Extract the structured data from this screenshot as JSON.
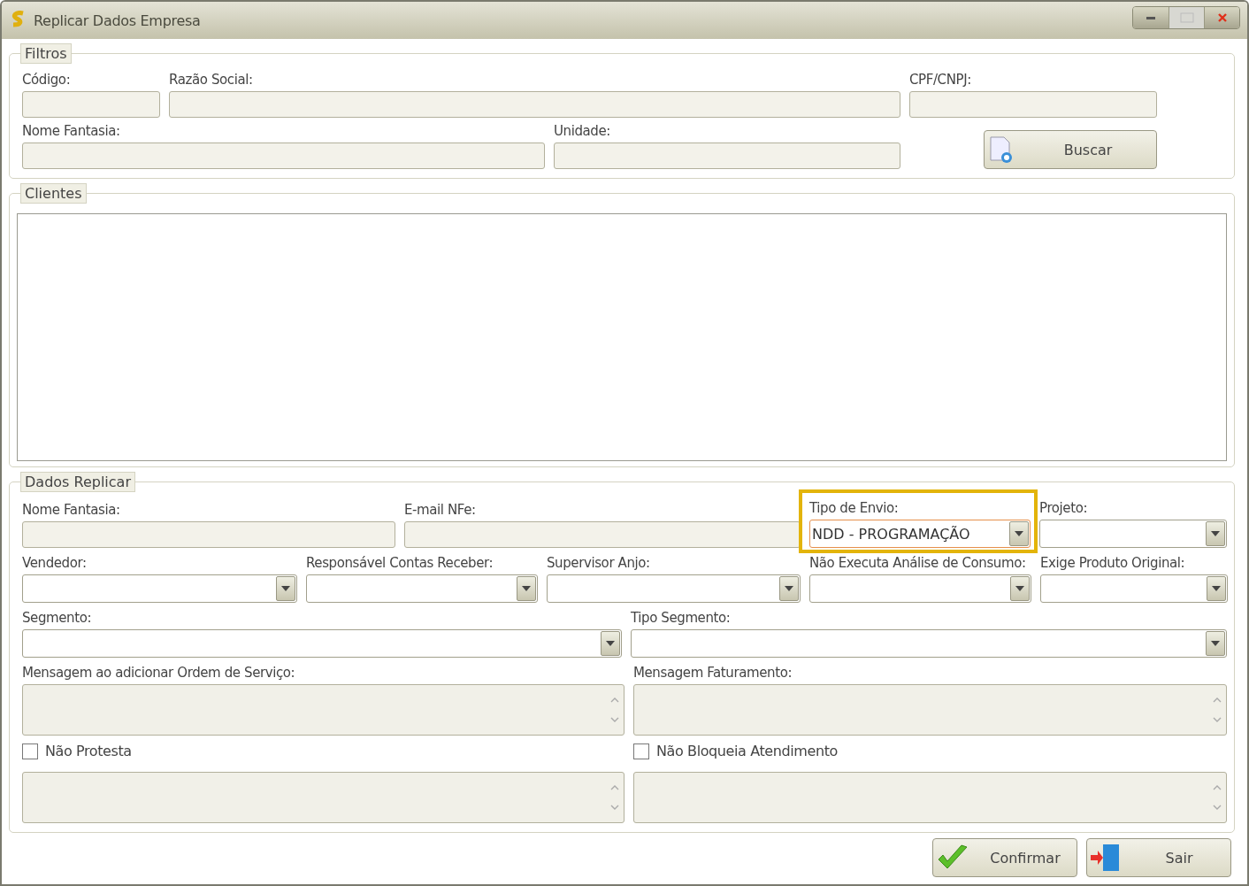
{
  "window": {
    "title": "Replicar Dados Empresa"
  },
  "filters": {
    "legend": "Filtros",
    "lines": [
      {
        "fields": [
          {
            "kind": "text",
            "label": "Código:"
          },
          {
            "kind": "text",
            "label": "Razão Social:"
          },
          {
            "kind": "text",
            "label": "CPF/CNPJ:"
          }
        ]
      },
      {
        "fields": [
          {
            "kind": "text",
            "label": "Nome Fantasia:"
          },
          {
            "kind": "text",
            "label": "Unidade:"
          },
          {
            "kind": "button",
            "label": "Buscar"
          }
        ]
      }
    ]
  },
  "clients": {
    "legend": "Clientes"
  },
  "replicate": {
    "legend": "Dados Replicar",
    "lines": [
      {
        "fields": [
          {
            "kind": "text",
            "label": "Nome Fantasia:"
          },
          {
            "kind": "text",
            "label": "E-mail NFe:"
          },
          {
            "kind": "combo",
            "label": "Tipo de Envio:",
            "value": "NDD - PROGRAMAÇÃO",
            "highlighted": true
          },
          {
            "kind": "combo",
            "label": "Projeto:"
          }
        ]
      },
      {
        "fields": [
          {
            "kind": "combo",
            "label": "Vendedor:"
          },
          {
            "kind": "combo",
            "label": "Responsável Contas Receber:"
          },
          {
            "kind": "combo",
            "label": "Supervisor Anjo:"
          },
          {
            "kind": "combo",
            "label": "Não Executa Análise de Consumo:"
          },
          {
            "kind": "combo",
            "label": "Exige Produto Original:"
          }
        ]
      },
      {
        "fields": [
          {
            "kind": "combo",
            "label": "Segmento:"
          },
          {
            "kind": "combo",
            "label": "Tipo Segmento:"
          }
        ]
      },
      {
        "fields": [
          {
            "kind": "memo",
            "label": "Mensagem ao adicionar Ordem de Serviço:"
          },
          {
            "kind": "memo",
            "label": "Mensagem Faturamento:"
          }
        ]
      },
      {
        "fields": [
          {
            "kind": "memo",
            "checkbox": {
              "label": "Não Protesta",
              "checked": false
            }
          },
          {
            "kind": "memo",
            "checkbox": {
              "label": "Não Bloqueia Atendimento",
              "checked": false
            }
          }
        ]
      }
    ]
  },
  "buttons": [
    {
      "kind": "confirm",
      "label": "Confirmar"
    },
    {
      "kind": "exit",
      "label": "Sair"
    }
  ]
}
